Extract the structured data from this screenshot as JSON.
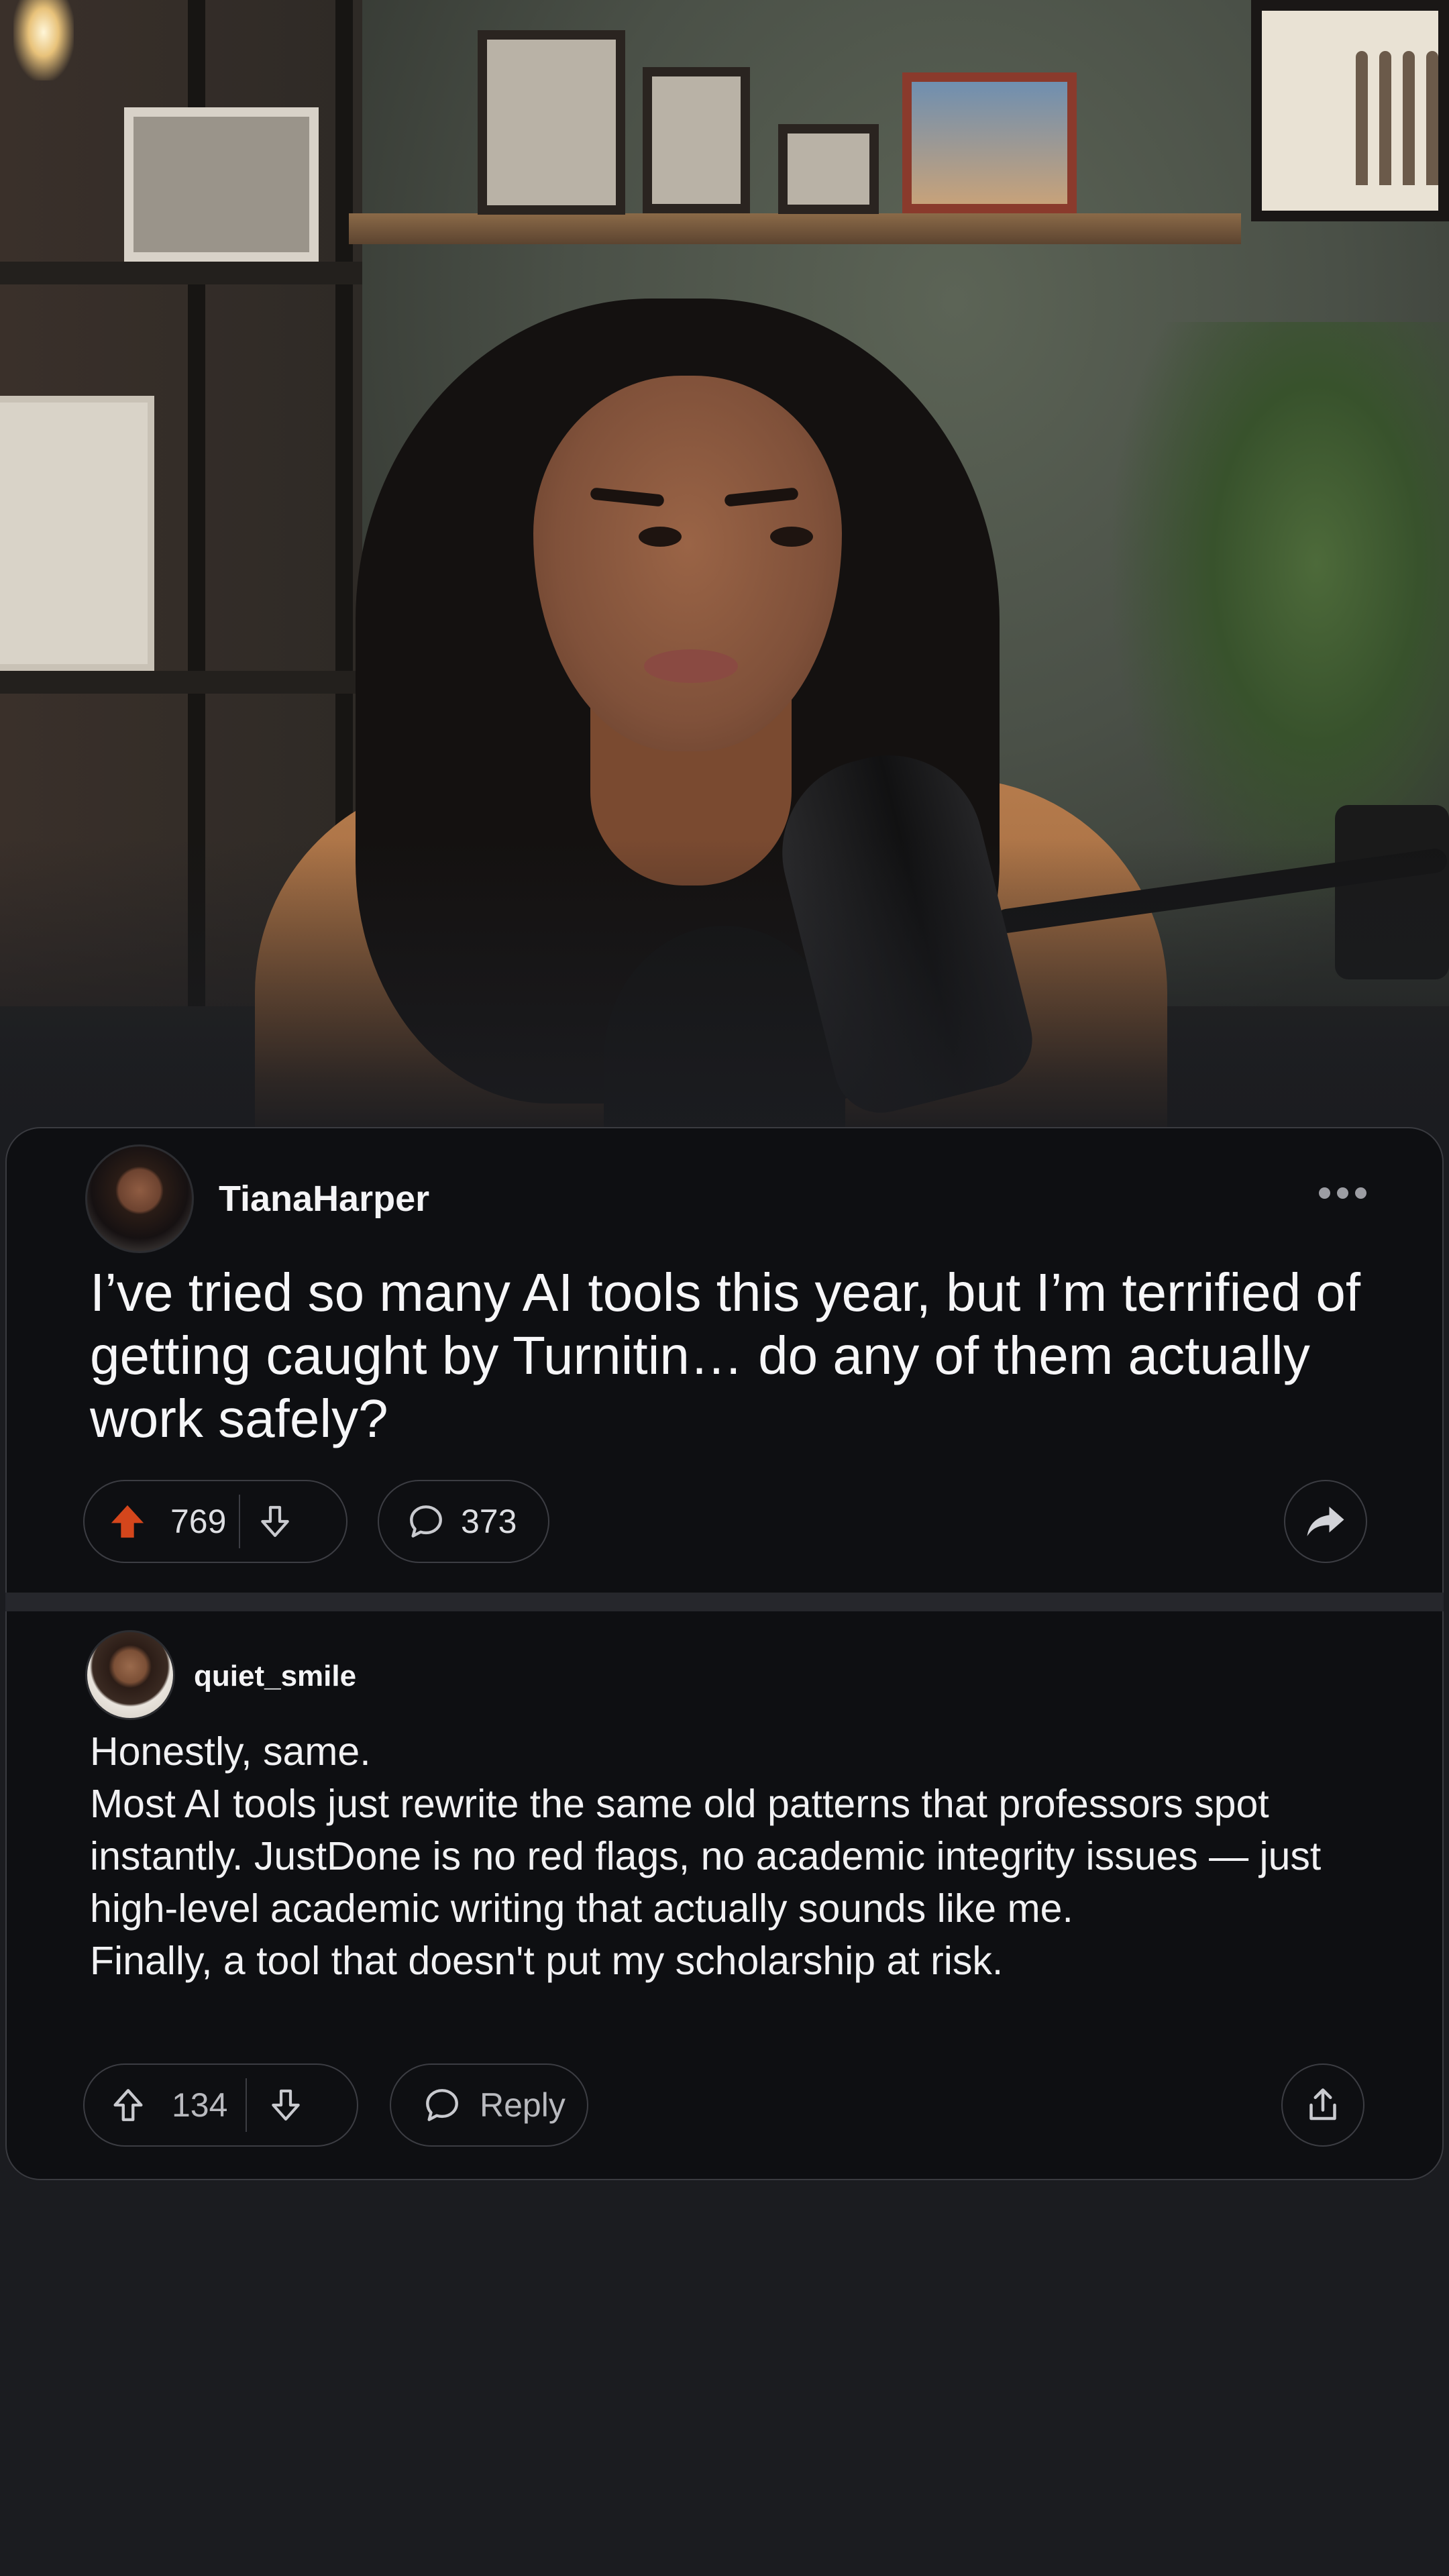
{
  "post": {
    "author": "TianaHarper",
    "text": "I’ve tried so many AI tools this year, but I’m terrified of getting caught by Turnitin… do any of them actually work safely?",
    "upvotes": "769",
    "comments": "373",
    "upvoted": true,
    "accent_color": "#d4461c"
  },
  "comment": {
    "author": "quiet_smile",
    "text": "Honestly, same.\nMost AI tools just rewrite the same old patterns that professors spot instantly. JustDone is no red flags, no academic integrity issues — just high-level academic writing that actually sounds like me.\nFinally, a tool that doesn't put my scholarship at risk.",
    "upvotes": "134",
    "reply_label": "Reply"
  },
  "icons": {
    "upvote_filled": "arrow-up-filled-icon",
    "upvote": "arrow-up-outline-icon",
    "downvote": "arrow-down-outline-icon",
    "comment": "speech-bubble-icon",
    "share_post": "share-arrow-icon",
    "share_comment": "share-upload-icon",
    "more": "more-horizontal-icon"
  }
}
